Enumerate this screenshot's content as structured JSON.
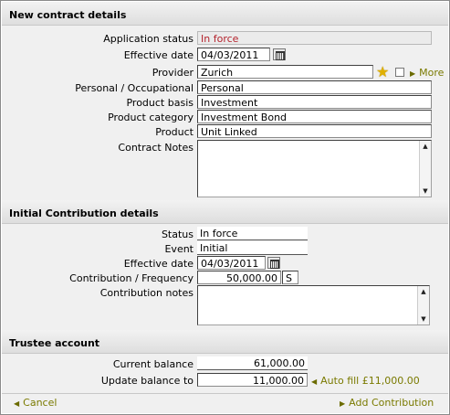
{
  "contract": {
    "header": "New contract details",
    "application_status_label": "Application status",
    "application_status_value": "In force",
    "effective_date_label": "Effective date",
    "effective_date_value": "04/03/2011",
    "provider_label": "Provider",
    "provider_value": "Zurich",
    "more_label": "More",
    "personal_occupational_label": "Personal / Occupational",
    "personal_occupational_value": "Personal",
    "product_basis_label": "Product basis",
    "product_basis_value": "Investment",
    "product_category_label": "Product category",
    "product_category_value": "Investment Bond",
    "product_label": "Product",
    "product_value": "Unit Linked",
    "contract_notes_label": "Contract Notes",
    "contract_notes_value": ""
  },
  "contribution": {
    "header": "Initial Contribution details",
    "status_label": "Status",
    "status_value": "In force",
    "event_label": "Event",
    "event_value": "Initial",
    "effective_date_label": "Effective date",
    "effective_date_value": "04/03/2011",
    "contribution_frequency_label": "Contribution / Frequency",
    "contribution_value": "50,000.00",
    "frequency_value": "S",
    "contribution_notes_label": "Contribution notes",
    "contribution_notes_value": ""
  },
  "trustee": {
    "header": "Trustee account",
    "current_balance_label": "Current balance",
    "current_balance_value": "61,000.00",
    "update_balance_label": "Update balance to",
    "update_balance_value": "11,000.00",
    "auto_fill_label": "Auto fill £11,000.00"
  },
  "footer": {
    "cancel_label": "Cancel",
    "add_contribution_label": "Add Contribution"
  },
  "icons": {
    "calendar": "calendar-icon",
    "favourite": "star-icon",
    "more_arrow": "arrow-right-icon",
    "cancel_arrow": "arrow-left-icon"
  },
  "colors": {
    "status_text": "#b4232d",
    "link_text": "#7a7a00",
    "star": "#e0b000"
  }
}
